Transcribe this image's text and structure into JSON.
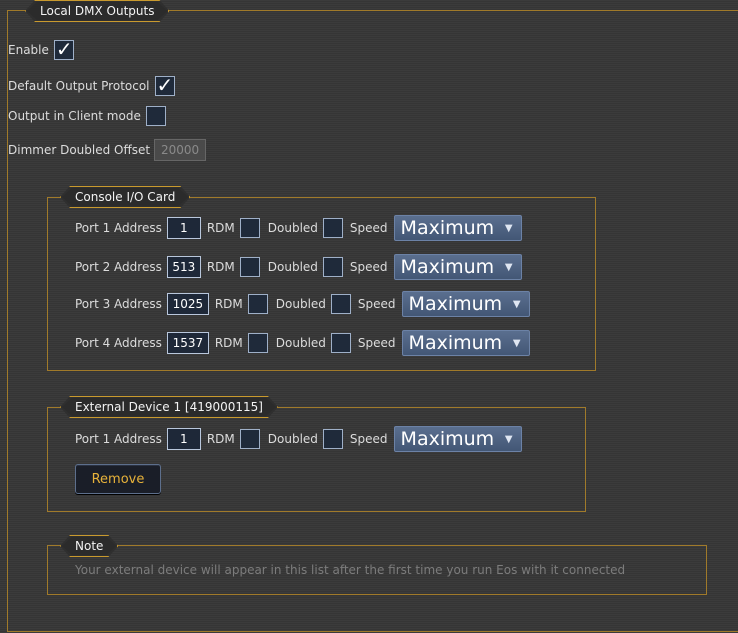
{
  "local": {
    "title": "Local DMX Outputs",
    "enable_label": "Enable",
    "default_protocol_label": "Default Output Protocol",
    "client_mode_label": "Output in Client mode",
    "dimmer_offset_label": "Dimmer Doubled Offset",
    "dimmer_offset_value": "20000"
  },
  "console_card": {
    "title": "Console I/O Card",
    "ports": [
      {
        "label": "Port 1 Address",
        "address": "1",
        "rdm": "RDM",
        "doubled": "Doubled",
        "speed": "Speed",
        "speed_value": "Maximum"
      },
      {
        "label": "Port 2 Address",
        "address": "513",
        "rdm": "RDM",
        "doubled": "Doubled",
        "speed": "Speed",
        "speed_value": "Maximum"
      },
      {
        "label": "Port 3 Address",
        "address": "1025",
        "rdm": "RDM",
        "doubled": "Doubled",
        "speed": "Speed",
        "speed_value": "Maximum"
      },
      {
        "label": "Port 4 Address",
        "address": "1537",
        "rdm": "RDM",
        "doubled": "Doubled",
        "speed": "Speed",
        "speed_value": "Maximum"
      }
    ]
  },
  "external": {
    "title": "External Device 1  [419000115]",
    "port": {
      "label": "Port 1 Address",
      "address": "1",
      "rdm": "RDM",
      "doubled": "Doubled",
      "speed": "Speed",
      "speed_value": "Maximum"
    },
    "remove_label": "Remove"
  },
  "note": {
    "title": "Note",
    "text": "Your external device will appear in this list after the first time you run Eos with it connected"
  },
  "colors": {
    "accent_border": "#a07a2a",
    "button_text": "#e7b23a",
    "dropdown_bg": "#4f6484"
  }
}
